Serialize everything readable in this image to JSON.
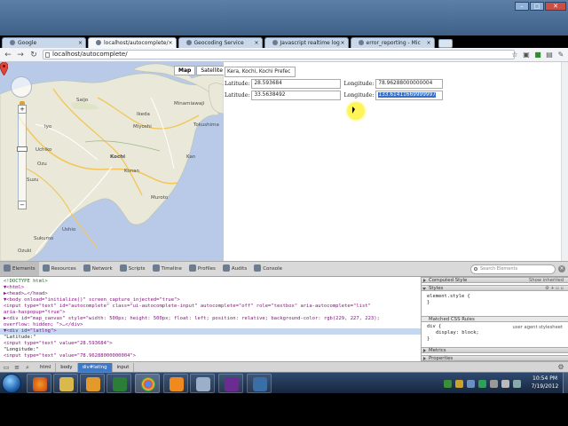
{
  "browser": {
    "tabs": [
      {
        "label": "Google",
        "active": false
      },
      {
        "label": "localhost/autocomplete/",
        "active": true
      },
      {
        "label": "Geocoding Service",
        "active": false
      },
      {
        "label": "Javascript realtime log",
        "active": false
      },
      {
        "label": "error_reporting - Mic",
        "active": false
      }
    ],
    "url": "localhost/autocomplete/"
  },
  "map": {
    "type_buttons": {
      "map": "Map",
      "satellite": "Satellite"
    },
    "labels": {
      "kochi": "Kochi",
      "konan": "Konan",
      "muroto": "Muroto",
      "miyoshi": "Miyoshi",
      "tokushima": "Tokushima",
      "minamiawaji": "Minamiawaji",
      "iyo": "Iyo",
      "uchiko": "Uchiko",
      "suzu": "Suzu",
      "ozu": "Ozu",
      "sukumo": "Sukumo",
      "ozuki": "Ozuki",
      "ushio": "Ushio",
      "kan": "Kan",
      "ikeda": "Ikeda",
      "saijo": "Saijo"
    }
  },
  "form": {
    "location_value": "Kera, Kochi, Kochi Prefec",
    "row1": {
      "lat_label": "Latitude:",
      "lat_value": "28.593684",
      "lng_label": "Longitude:",
      "lng_value": "78.96288000000004"
    },
    "row2": {
      "lat_label": "Latitude:",
      "lat_value": "33.5638492",
      "lng_label": "Longitude:",
      "lng_value": "133.61411669999997"
    }
  },
  "devtools": {
    "tabs": [
      "Elements",
      "Resources",
      "Network",
      "Scripts",
      "Timeline",
      "Profiles",
      "Audits",
      "Console"
    ],
    "search_placeholder": "Search Elements",
    "elements": [
      "<!DOCTYPE html>",
      "▼<html>",
      "  ▶<head>…</head>",
      "  ▼<body onload=\"initialize()\" screen_capture_injected=\"true\">",
      "      <input type=\"text\" id=\"autocomplete\" class=\"ui-autocomplete-input\" autocomplete=\"off\" role=\"textbox\" aria-autocomplete=\"list\"",
      "      aria-haspopup=\"true\">",
      "    ▶<div id=\"map_canvas\" style=\"width: 500px; height: 500px; float: left; position: relative; background-color: rgb(229, 227, 223);",
      "      overflow: hidden; \">…</div>",
      "    ▼<div id=\"latlng\">",
      "        \"Latitude:\"",
      "        <input type=\"text\" value=\"28.593684\">",
      "        \"Longitude:\"",
      "        <input type=\"text\" value=\"78.96288000000004\">"
    ],
    "sidebar": {
      "computed": "Computed Style",
      "show_inherited": "Show inherited",
      "styles": "Styles",
      "element_style": "element.style {",
      "element_style_close": "}",
      "matched": "Matched CSS Rules",
      "rule_selector": "div {",
      "rule_prop": "display: block;",
      "rule_close": "}",
      "rule_source": "user agent stylesheet",
      "metrics": "Metrics",
      "properties": "Properties"
    },
    "breadcrumbs": [
      "html",
      "body",
      "div#latlng",
      "input"
    ]
  },
  "taskbar": {
    "time": "10:54 PM",
    "date": "7/19/2012"
  },
  "colors": {
    "accent": "#3d79c9",
    "map_water": "#b8cae7",
    "map_land": "#eae8d8"
  }
}
